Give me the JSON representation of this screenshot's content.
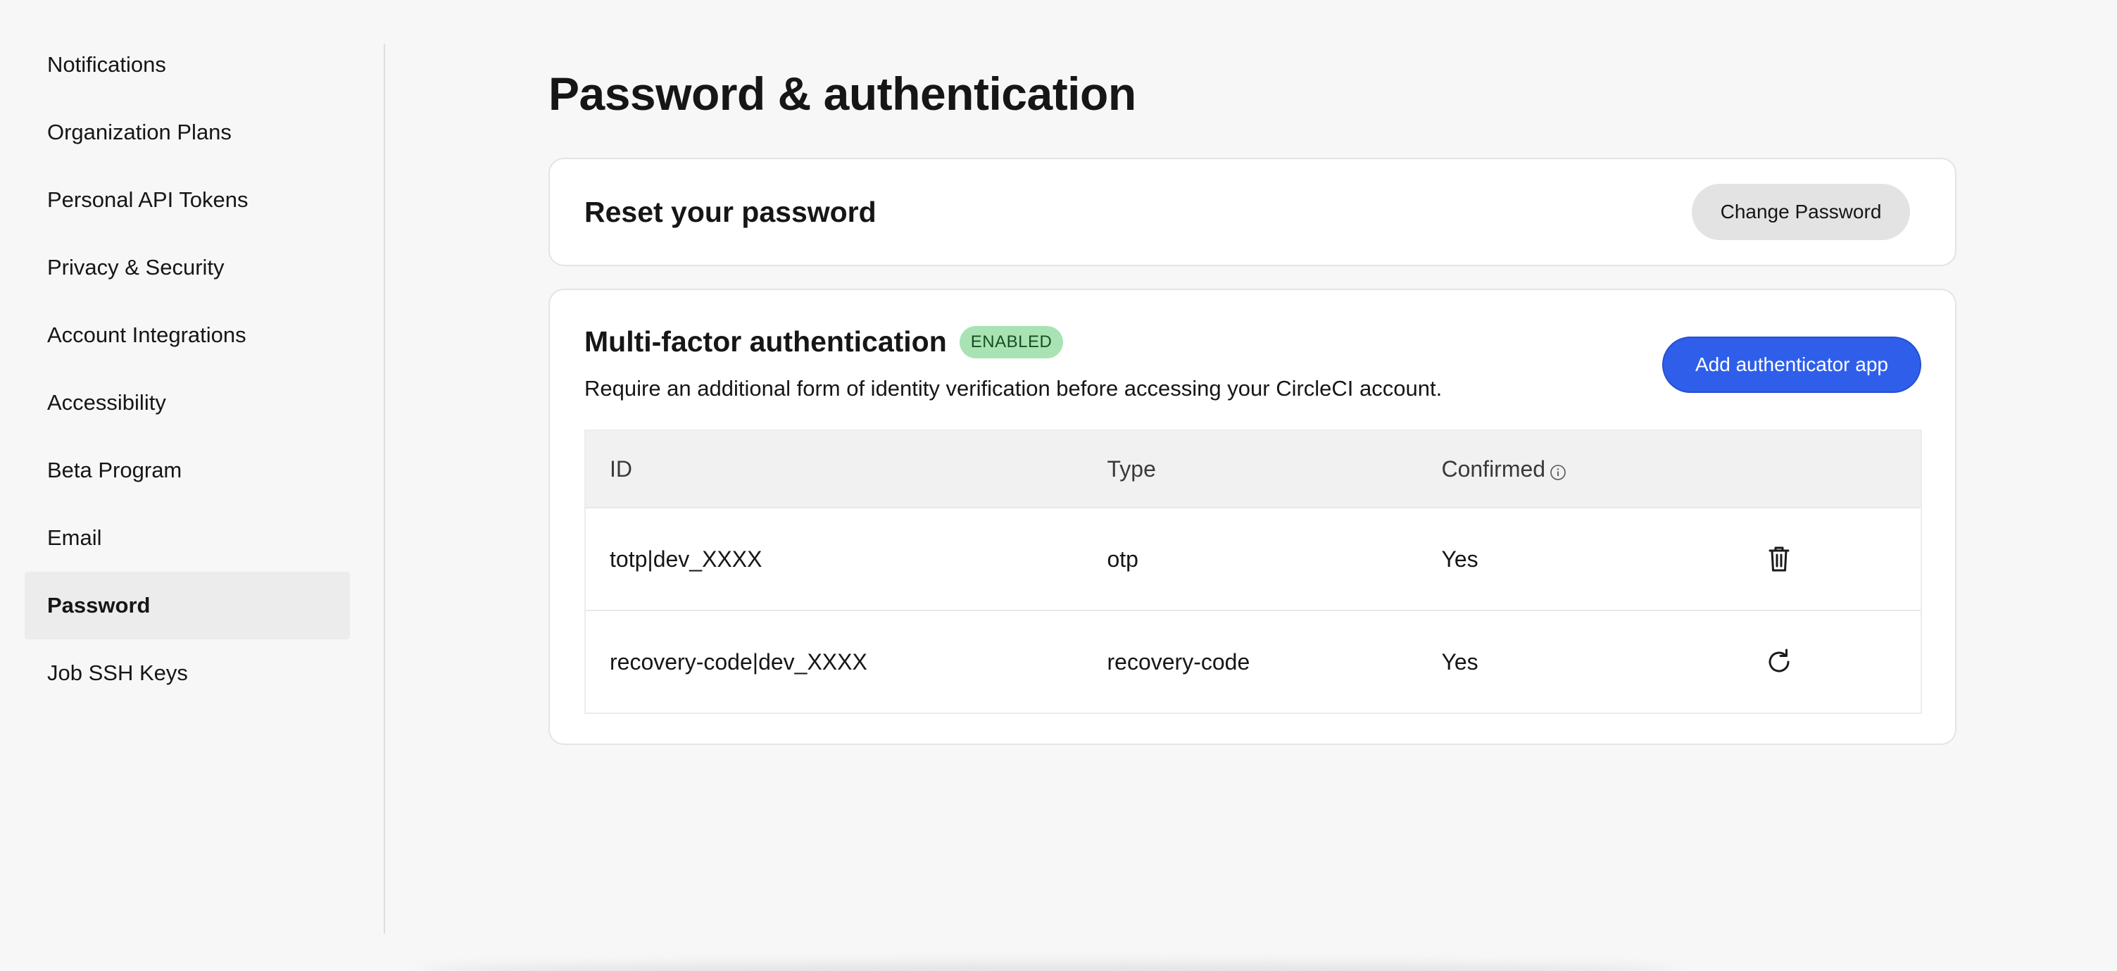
{
  "sidebar": {
    "items": [
      {
        "label": "Notifications"
      },
      {
        "label": "Organization Plans"
      },
      {
        "label": "Personal API Tokens"
      },
      {
        "label": "Privacy & Security"
      },
      {
        "label": "Account Integrations"
      },
      {
        "label": "Accessibility"
      },
      {
        "label": "Beta Program"
      },
      {
        "label": "Email"
      },
      {
        "label": "Password",
        "active": true
      },
      {
        "label": "Job SSH Keys"
      }
    ]
  },
  "main": {
    "title": "Password & authentication",
    "reset": {
      "title": "Reset your password",
      "button_label": "Change Password"
    },
    "mfa": {
      "title": "Multi-factor authentication",
      "badge": "ENABLED",
      "badge_color": "#a9e3b3",
      "description": "Require an additional form of identity verification before accessing your CircleCI account.",
      "button_label": "Add authenticator app",
      "button_color": "#2f5fea",
      "table": {
        "headers": {
          "id": "ID",
          "type": "Type",
          "confirmed": "Confirmed"
        },
        "confirmed_info_icon": "info-icon",
        "rows": [
          {
            "id": "totp|dev_XXXX",
            "type": "otp",
            "confirmed": "Yes",
            "action_icon": "trash-icon"
          },
          {
            "id": "recovery-code|dev_XXXX",
            "type": "recovery-code",
            "confirmed": "Yes",
            "action_icon": "refresh-icon"
          }
        ]
      }
    }
  }
}
